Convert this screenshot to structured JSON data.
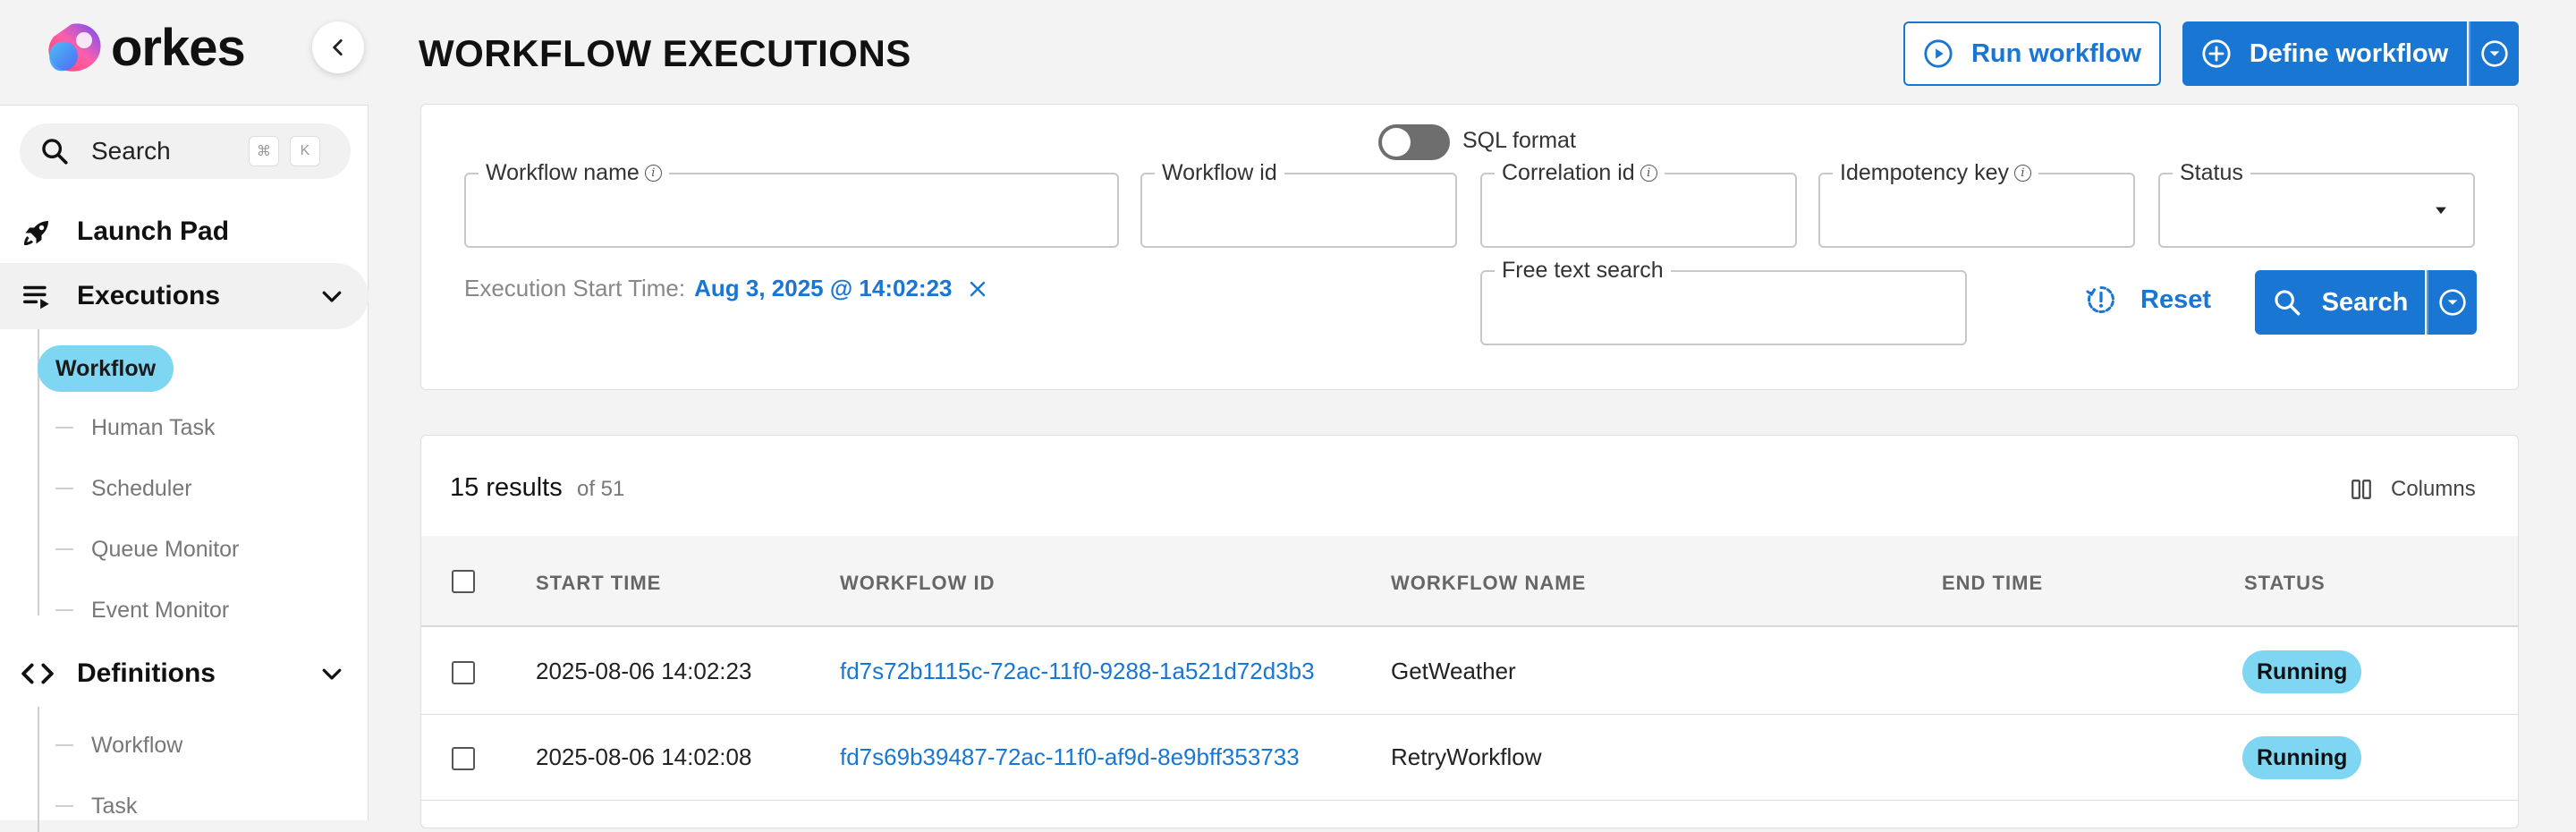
{
  "brand": {
    "name": "orkes"
  },
  "sidebar": {
    "search": {
      "label": "Search",
      "kbd": [
        "⌘",
        "K"
      ]
    },
    "launch_pad": "Launch Pad",
    "executions": {
      "label": "Executions",
      "items": [
        "Workflow",
        "Human Task",
        "Scheduler",
        "Queue Monitor",
        "Event Monitor"
      ],
      "active": "Workflow"
    },
    "definitions": {
      "label": "Definitions",
      "items": [
        "Workflow",
        "Task"
      ]
    }
  },
  "header": {
    "title": "WORKFLOW EXECUTIONS",
    "run_button": "Run workflow",
    "define_button": "Define workflow"
  },
  "filters": {
    "workflow_name": "Workflow name",
    "workflow_id": "Workflow id",
    "correlation_id": "Correlation id",
    "idempotency_key": "Idempotency key",
    "status": "Status",
    "sql_format": "SQL format",
    "free_text": "Free text search",
    "exec_start_label": "Execution Start Time:",
    "exec_start_value": "Aug 3, 2025 @ 14:02:23",
    "reset": "Reset",
    "search": "Search"
  },
  "results": {
    "count": "15 results",
    "of": "of 51",
    "columns_button": "Columns",
    "headers": [
      "START TIME",
      "WORKFLOW ID",
      "WORKFLOW NAME",
      "END TIME",
      "STATUS"
    ],
    "rows": [
      {
        "start_time": "2025-08-06 14:02:23",
        "workflow_id": "fd7s72b1115c-72ac-11f0-9288-1a521d72d3b3",
        "workflow_name": "GetWeather",
        "end_time": "",
        "status": "Running"
      },
      {
        "start_time": "2025-08-06 14:02:08",
        "workflow_id": "fd7s69b39487-72ac-11f0-af9d-8e9bff353733",
        "workflow_name": "RetryWorkflow",
        "end_time": "",
        "status": "Running"
      }
    ]
  },
  "colors": {
    "accent": "#1976d2",
    "running_badge": "#7fd6f3",
    "active_nav": "#7fd6f3"
  },
  "icons": {
    "logo": "orkes-logo-icon",
    "collapse": "chevron-left-icon",
    "search": "search-icon",
    "launch_pad": "rocket-icon",
    "executions": "list-play-icon",
    "definitions": "code-icon",
    "run": "play-circle-icon",
    "define": "plus-circle-icon",
    "dropdown": "chevron-down-circle-icon",
    "reset": "reset-icon",
    "columns": "columns-icon",
    "clear": "close-icon"
  }
}
